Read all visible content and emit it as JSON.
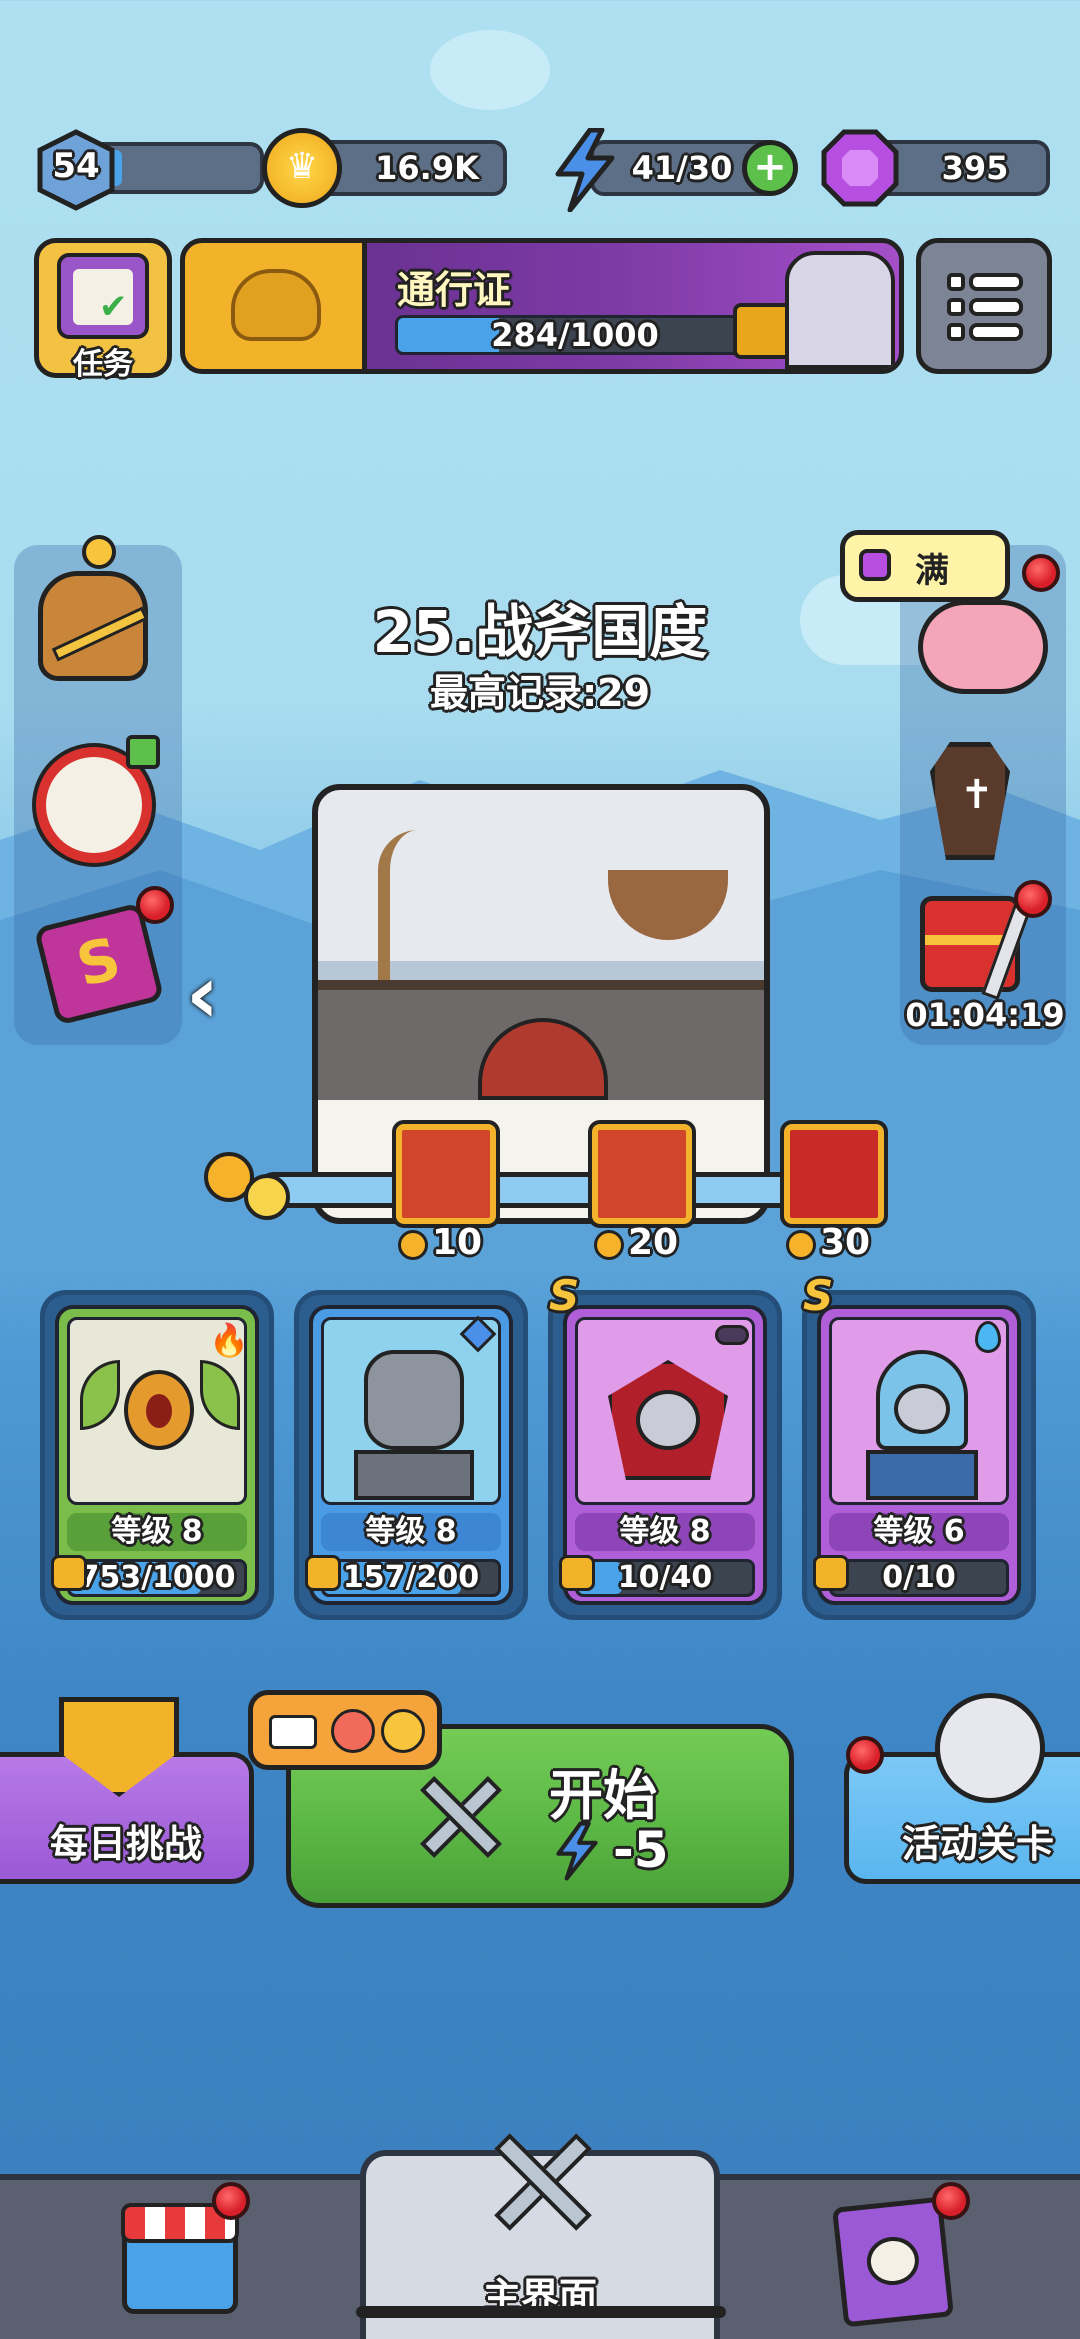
{
  "player": {
    "level": "54",
    "level_progress": 0.15
  },
  "resources": {
    "gold": "16.9K",
    "energy": "41/30",
    "gems": "395"
  },
  "tasks": {
    "label": "任务"
  },
  "pass": {
    "title": "通行证",
    "progress": "284/1000",
    "progress_fraction": 0.284
  },
  "piggy_bank": {
    "label": "满"
  },
  "stage": {
    "title": "25.战斧国度",
    "best_record": "最高记录:29"
  },
  "timer": "01:04:19",
  "rewards": [
    {
      "days": "10"
    },
    {
      "days": "20"
    },
    {
      "days": "30"
    }
  ],
  "heroes": [
    {
      "name": "eye-dragon",
      "rank": "",
      "level": "等级 8",
      "progress": "753/1000",
      "progress_fraction": 0.753,
      "color": "#7bbd4a"
    },
    {
      "name": "armored-knight",
      "rank": "",
      "level": "等级 8",
      "progress": "157/200",
      "progress_fraction": 0.785,
      "color": "#4a9be3"
    },
    {
      "name": "vampire",
      "rank": "S",
      "level": "等级 8",
      "progress": "10/40",
      "progress_fraction": 0.25,
      "color": "#b05fd8"
    },
    {
      "name": "ice-mage",
      "rank": "S",
      "level": "等级 6",
      "progress": "0/10",
      "progress_fraction": 0.0,
      "color": "#b05fd8"
    }
  ],
  "actions": {
    "daily_challenge": "每日挑战",
    "start": "开始",
    "start_cost": "-5",
    "event_stage": "活动关卡"
  },
  "nav": {
    "main": "主界面"
  },
  "colors": {
    "green": "#5cb845",
    "purple": "#9b59d6",
    "blue": "#5ab6ef",
    "gold": "#f2b32a"
  }
}
